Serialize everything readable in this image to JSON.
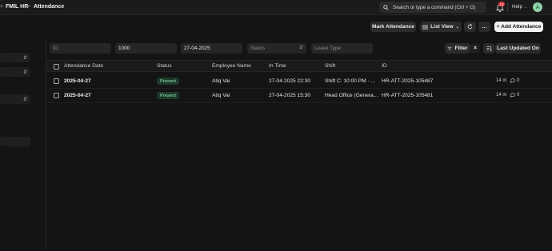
{
  "navbar": {
    "breadcrumbs": [
      ">",
      "FMIL HR",
      ">",
      "Attendance"
    ],
    "search_placeholder": "Search or type a command (Ctrl + G)",
    "notification_count": "10",
    "help_label": "Help",
    "avatar_initial": "A"
  },
  "page_actions": {
    "mark_attendance": "Mark Attendance",
    "list_view": "List View",
    "more": "...",
    "add": "+ Add Attendance"
  },
  "filters": {
    "id_placeholder": "ID",
    "employee_value": "1000",
    "date_value": "27-04-2025",
    "status_placeholder": "Status",
    "leave_type_placeholder": "Leave Type",
    "filter_label": "Filter",
    "sort_label": "Last Updated On"
  },
  "table": {
    "columns": [
      "Attendance Date",
      "Status",
      "Employee Name",
      "In Time",
      "Shift",
      "ID"
    ],
    "rows": [
      {
        "date": "2025-04-27",
        "status": "Present",
        "employee": "Atiq Vai",
        "in_time": "27-04-2025 22:30",
        "shift": "Shift C: 10:00 PM - ...",
        "id": "HR-ATT-2025-105487",
        "age": "14 m",
        "comments": "0"
      },
      {
        "date": "2025-04-27",
        "status": "Present",
        "employee": "Atiq Vai",
        "in_time": "27-04-2025 15:30",
        "shift": "Head Office (Genera...",
        "id": "HR-ATT-2025-105481",
        "age": "14 m",
        "comments": "0"
      }
    ]
  },
  "colors": {
    "background": "#141414",
    "status_present_bg": "#1d3b2a",
    "status_present_text": "#8fe0b0",
    "badge": "#e03131",
    "avatar": "#8fd1a8"
  }
}
